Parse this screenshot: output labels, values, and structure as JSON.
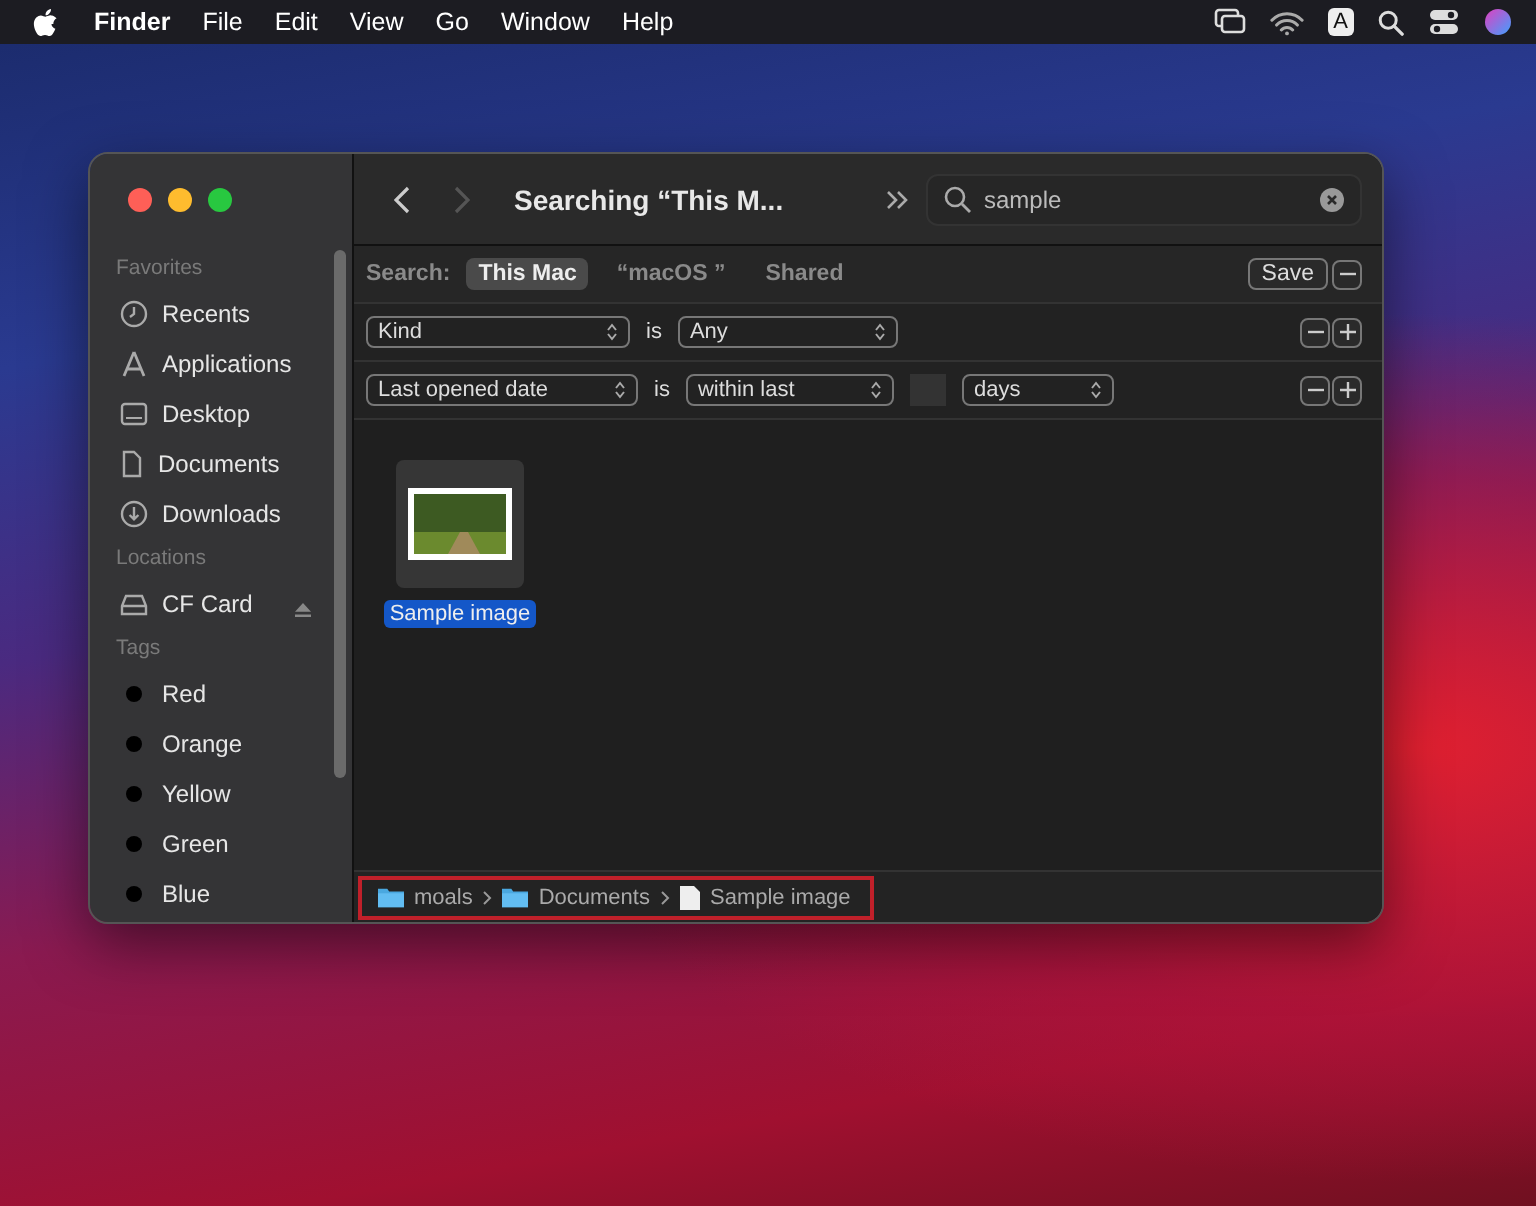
{
  "menu_bar": {
    "app_name": "Finder",
    "menus": [
      "File",
      "Edit",
      "View",
      "Go",
      "Window",
      "Help"
    ],
    "input_source": "A"
  },
  "window": {
    "title": "Searching “This M...",
    "search": {
      "value": "sample"
    },
    "sidebar": [
      {
        "heading": "Favorites",
        "items": [
          {
            "label": "Recents",
            "kind": "recents",
            "selected": false
          },
          {
            "label": "Applications",
            "kind": "applications",
            "selected": false
          },
          {
            "label": "Desktop",
            "kind": "desktop",
            "selected": false
          },
          {
            "label": "Documents",
            "kind": "documents",
            "selected": false
          },
          {
            "label": "Downloads",
            "kind": "downloads",
            "selected": false
          }
        ]
      },
      {
        "heading": "Locations",
        "items": [
          {
            "label": "CF Card",
            "kind": "volume",
            "selected": false,
            "ejectable": true
          }
        ]
      },
      {
        "heading": "Tags",
        "items": [
          {
            "label": "Red",
            "kind": "tag",
            "selected": false
          },
          {
            "label": "Orange",
            "kind": "tag",
            "selected": false
          },
          {
            "label": "Yellow",
            "kind": "tag",
            "selected": false
          },
          {
            "label": "Green",
            "kind": "tag",
            "selected": false
          },
          {
            "label": "Blue",
            "kind": "tag",
            "selected": false
          }
        ]
      }
    ],
    "scope_bar": {
      "label": "Search:",
      "scopes": [
        {
          "label": "This Mac",
          "selected": true
        },
        {
          "label": "“macOS ”",
          "selected": false
        },
        {
          "label": "Shared",
          "selected": false
        }
      ],
      "save_button": "Save"
    },
    "criteria": [
      {
        "kind": "simple",
        "attribute": "Kind",
        "operator": "is",
        "value": "Any"
      },
      {
        "kind": "date",
        "attribute": "Last opened date",
        "operator": "is",
        "value": "within last",
        "unit": "days"
      }
    ],
    "files": [
      {
        "name": "Sample image",
        "selected": true
      }
    ],
    "path_bar": {
      "highlighted": true,
      "items": [
        {
          "label": "moals",
          "kind": "folder"
        },
        {
          "label": "Documents",
          "kind": "folder"
        },
        {
          "label": "Sample image",
          "kind": "file"
        }
      ]
    }
  }
}
